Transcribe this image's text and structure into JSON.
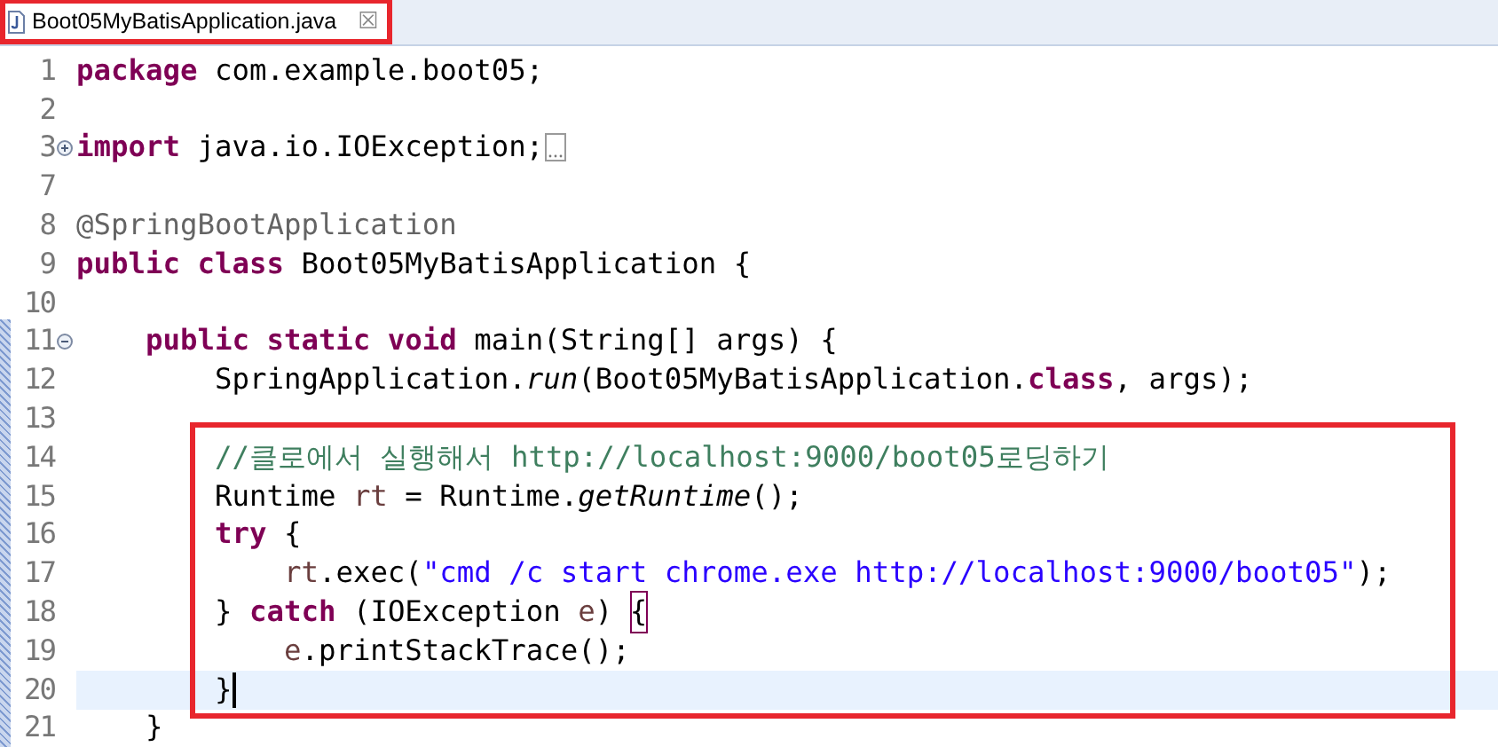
{
  "tab": {
    "title": "Boot05MyBatisApplication.java",
    "close": "☒",
    "highlighted": true
  },
  "lines": [
    {
      "number": "1",
      "tokens": [
        {
          "kind": "keyword",
          "text": "package"
        },
        {
          "kind": "plain",
          "text": " com.example.boot05;"
        }
      ]
    },
    {
      "number": "2"
    },
    {
      "number": "3",
      "folded": true,
      "tokens": [
        {
          "kind": "keyword",
          "text": "import"
        },
        {
          "kind": "plain",
          "text": " java.io.IOException;"
        }
      ]
    },
    {
      "number": "7"
    },
    {
      "number": "8",
      "tokens": [
        {
          "kind": "annotation",
          "text": "@SpringBootApplication"
        }
      ]
    },
    {
      "number": "9",
      "tokens": [
        {
          "kind": "keyword",
          "text": "public class"
        },
        {
          "kind": "plain",
          "text": " Boot05MyBatisApplication {"
        }
      ]
    },
    {
      "number": "10"
    },
    {
      "number": "11",
      "folded": false,
      "tokens": [
        {
          "kind": "keyword",
          "text": "    public static void"
        },
        {
          "kind": "plain",
          "text": " main(String[] args) {"
        }
      ]
    },
    {
      "number": "12",
      "tokens": [
        {
          "kind": "plain",
          "text": "        SpringApplication."
        },
        {
          "kind": "italic",
          "text": "run"
        },
        {
          "kind": "plain",
          "text": "(Boot05MyBatisApplication."
        },
        {
          "kind": "keyword",
          "text": "class"
        },
        {
          "kind": "plain",
          "text": ", args);"
        }
      ]
    },
    {
      "number": "13"
    },
    {
      "number": "14",
      "boxed": true,
      "tokens": [
        {
          "kind": "comment",
          "text": "        //클로에서 실행해서 http://localhost:9000/boot05로딩하기"
        }
      ]
    },
    {
      "number": "15",
      "boxed": true,
      "tokens": [
        {
          "kind": "plain",
          "text": "        Runtime "
        },
        {
          "kind": "variable",
          "text": "rt"
        },
        {
          "kind": "plain",
          "text": " = Runtime."
        },
        {
          "kind": "italic",
          "text": "getRuntime"
        },
        {
          "kind": "plain",
          "text": "();"
        }
      ]
    },
    {
      "number": "16",
      "boxed": true,
      "tokens": [
        {
          "kind": "keyword",
          "text": "        try"
        },
        {
          "kind": "plain",
          "text": " {"
        }
      ]
    },
    {
      "number": "17",
      "boxed": true,
      "tokens": [
        {
          "kind": "variable",
          "text": "            rt"
        },
        {
          "kind": "plain",
          "text": ".exec("
        },
        {
          "kind": "string",
          "text": "\"cmd /c start chrome.exe http://localhost:9000/boot05\""
        },
        {
          "kind": "plain",
          "text": ");"
        }
      ]
    },
    {
      "number": "18",
      "boxed": true,
      "tokens": [
        {
          "kind": "plain",
          "text": "        } "
        },
        {
          "kind": "keyword",
          "text": "catch"
        },
        {
          "kind": "plain",
          "text": " (IOException "
        },
        {
          "kind": "variable",
          "text": "e"
        },
        {
          "kind": "plain",
          "text": ") "
        },
        {
          "kind": "bracket_match",
          "text": "{"
        }
      ]
    },
    {
      "number": "19",
      "boxed": true,
      "tokens": [
        {
          "kind": "variable",
          "text": "            e"
        },
        {
          "kind": "plain",
          "text": ".printStackTrace();"
        }
      ]
    },
    {
      "number": "20",
      "boxed": true,
      "current": true,
      "cursor": true,
      "tokens": [
        {
          "kind": "plain",
          "text": "        }"
        }
      ]
    },
    {
      "number": "21",
      "tokens": [
        {
          "kind": "plain",
          "text": "    }"
        }
      ]
    }
  ]
}
